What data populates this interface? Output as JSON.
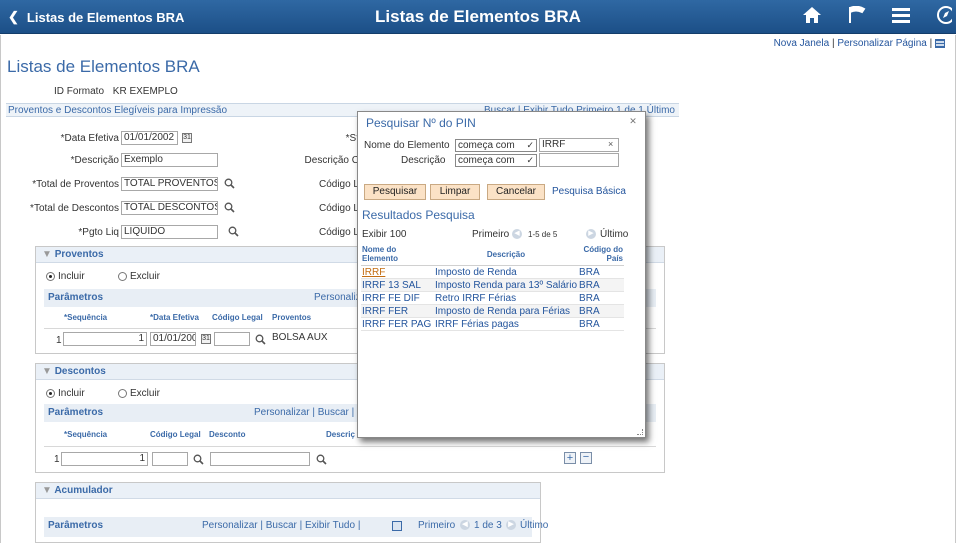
{
  "header": {
    "back_label": "Listas de Elementos BRA",
    "title": "Listas de Elementos BRA"
  },
  "toplinks": {
    "new_window": "Nova Janela",
    "sep": "|",
    "personalize": "Personalizar Página"
  },
  "page": {
    "title": "Listas de Elementos BRA",
    "id_label": "ID Formato",
    "id_value": "KR EXEMPLO"
  },
  "section": {
    "title": "Proventos e Descontos Elegíveis para Impressão",
    "nav": "Buscar | Exibir Tudo    Primeiro  1 de 1  Último"
  },
  "fields": {
    "data_efetiva_label": "*Data Efetiva",
    "data_efetiva": "01/01/2002",
    "descricao_label": "*Descrição",
    "descricao": "Exemplo",
    "total_prov_label": "*Total de Proventos",
    "total_prov": "TOTAL PROVENTOS",
    "total_desc_label": "*Total de Descontos",
    "total_desc": "TOTAL DESCONTOS",
    "pgto_label": "*Pgto Liq",
    "pgto": "LIQUIDO",
    "status_label": "*St",
    "descricao_c_label": "Descrição C",
    "codigo_l1": "Código L",
    "codigo_l2": "Código L",
    "codigo_l3": "Código L"
  },
  "proventos": {
    "title": "Proventos",
    "incluir": "Incluir",
    "excluir": "Excluir",
    "params": "Parâmetros",
    "personaliza": "Personaliza",
    "col_seq": "*Sequência",
    "col_data": "*Data Efetiva",
    "col_cod": "Código Legal",
    "col_prov": "Proventos",
    "row_num": "1",
    "row_seq": "1",
    "row_data": "01/01/2002",
    "row_prov": "BOLSA AUX"
  },
  "descontos": {
    "title": "Descontos",
    "incluir": "Incluir",
    "excluir": "Excluir",
    "params": "Parâmetros",
    "nav": "Personalizar | Buscar | Ex",
    "col_seq": "*Sequência",
    "col_cod": "Código Legal",
    "col_desc": "Desconto",
    "col_descri": "Descriç",
    "row_num": "1",
    "row_seq": "1"
  },
  "acumulador": {
    "title": "Acumulador",
    "params": "Parâmetros",
    "nav": "Personalizar | Buscar | Exibir Tudo |",
    "first": "Primeiro",
    "count": "1 de 3",
    "last": "Último"
  },
  "modal": {
    "title": "Pesquisar Nº do PIN",
    "nome_label": "Nome do Elemento",
    "nome_op": "começa com",
    "nome_value": "IRRF",
    "desc_label": "Descrição",
    "desc_op": "começa com",
    "desc_value": "",
    "btn_search": "Pesquisar",
    "btn_clear": "Limpar",
    "btn_cancel": "Cancelar",
    "basic_link": "Pesquisa Básica",
    "results_title": "Resultados Pesquisa",
    "show": "Exibir 100",
    "first": "Primeiro",
    "range": "1-5 de 5",
    "last": "Último",
    "headers": [
      "Nome do Elemento",
      "Descrição",
      "Código do País"
    ],
    "rows": [
      {
        "nome": "IRRF",
        "descricao": "Imposto de Renda",
        "pais": "BRA"
      },
      {
        "nome": "IRRF 13 SAL",
        "descricao": "Imposto Renda para 13º Salário",
        "pais": "BRA"
      },
      {
        "nome": "IRRF FE DIF",
        "descricao": "Retro IRRF Férias",
        "pais": "BRA"
      },
      {
        "nome": "IRRF FER",
        "descricao": "Imposto de Renda para Férias",
        "pais": "BRA"
      },
      {
        "nome": "IRRF FER PAG",
        "descricao": "IRRF Férias pagas",
        "pais": "BRA"
      }
    ]
  },
  "colors": {
    "header_bg": "#2f68a3",
    "link": "#24559d",
    "button_bg": "#fbe2c6"
  }
}
